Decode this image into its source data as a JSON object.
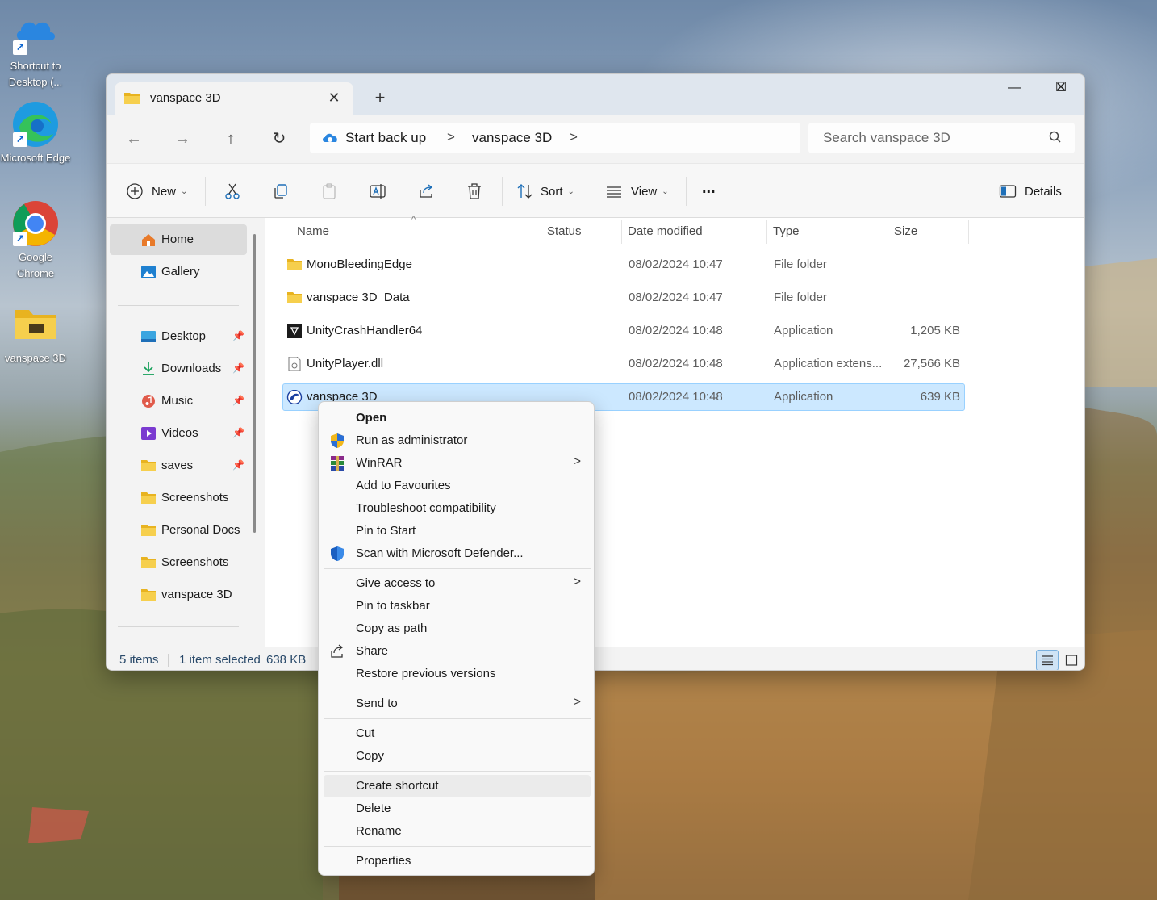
{
  "desktop": {
    "icons": [
      {
        "label": "Shortcut to Desktop (..."
      },
      {
        "label": "Microsoft Edge"
      },
      {
        "label": "Google Chrome"
      },
      {
        "label": "vanspace 3D"
      }
    ]
  },
  "window": {
    "tab_title": "vanspace 3D",
    "new_tab": "+",
    "controls": {
      "minimize": "—",
      "maximize": "☐",
      "close": "✕"
    }
  },
  "address": {
    "crumbs": [
      "Start back up",
      "vanspace 3D"
    ],
    "separator": ">",
    "search_placeholder": "Search vanspace 3D"
  },
  "toolbar": {
    "new_label": "New",
    "sort_label": "Sort",
    "view_label": "View",
    "more_label": "...",
    "details_label": "Details"
  },
  "sidebar": {
    "top": [
      {
        "label": "Home",
        "selected": true
      },
      {
        "label": "Gallery"
      }
    ],
    "items": [
      {
        "label": "Desktop",
        "pinned": true
      },
      {
        "label": "Downloads",
        "pinned": true
      },
      {
        "label": "Music",
        "pinned": true
      },
      {
        "label": "Videos",
        "pinned": true
      },
      {
        "label": "saves",
        "pinned": true
      },
      {
        "label": "Screenshots"
      },
      {
        "label": "Personal Docs"
      },
      {
        "label": "Screenshots"
      },
      {
        "label": "vanspace 3D"
      }
    ]
  },
  "columns": {
    "name": "Name",
    "status": "Status",
    "date": "Date modified",
    "type": "Type",
    "size": "Size"
  },
  "files": [
    {
      "name": "MonoBleedingEdge",
      "date": "08/02/2024 10:47",
      "type": "File folder",
      "size": ""
    },
    {
      "name": "vanspace 3D_Data",
      "date": "08/02/2024 10:47",
      "type": "File folder",
      "size": ""
    },
    {
      "name": "UnityCrashHandler64",
      "date": "08/02/2024 10:48",
      "type": "Application",
      "size": "1,205 KB"
    },
    {
      "name": "UnityPlayer.dll",
      "date": "08/02/2024 10:48",
      "type": "Application extens...",
      "size": "27,566 KB"
    },
    {
      "name": "vanspace 3D",
      "date": "08/02/2024 10:48",
      "type": "Application",
      "size": "639 KB"
    }
  ],
  "status": {
    "count": "5 items",
    "selection": "1 item selected",
    "sel_size": "638 KB"
  },
  "context_menu": {
    "open": "Open",
    "run_admin": "Run as administrator",
    "winrar": "WinRAR",
    "add_fav": "Add to Favourites",
    "troubleshoot": "Troubleshoot compatibility",
    "pin_start": "Pin to Start",
    "scan": "Scan with Microsoft Defender...",
    "give_access": "Give access to",
    "pin_taskbar": "Pin to taskbar",
    "copy_path": "Copy as path",
    "share": "Share",
    "restore": "Restore previous versions",
    "send_to": "Send to",
    "cut": "Cut",
    "copy": "Copy",
    "create_shortcut": "Create shortcut",
    "delete": "Delete",
    "rename": "Rename",
    "properties": "Properties",
    "submenu_arrow": ">"
  }
}
